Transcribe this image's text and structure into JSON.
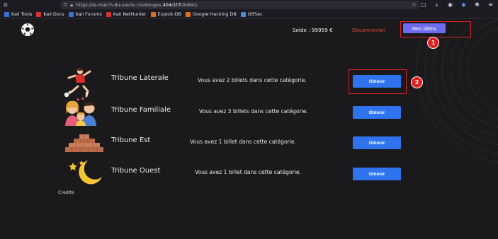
{
  "browser": {
    "url_prefix": "https://le-match-du-siecle.challenges.",
    "url_domain": "404ctf.fr",
    "url_path": "/billets",
    "bookmarks": [
      {
        "label": "Kali Tools",
        "color": "#3a74d8"
      },
      {
        "label": "Kali Docs",
        "color": "#d8322e"
      },
      {
        "label": "Kali Forums",
        "color": "#3a74d8"
      },
      {
        "label": "Kali NetHunter",
        "color": "#d8322e"
      },
      {
        "label": "Exploit-DB",
        "color": "#e0701e"
      },
      {
        "label": "Google Hacking DB",
        "color": "#e0701e"
      },
      {
        "label": "OffSec",
        "color": "#4a8ad8"
      }
    ]
  },
  "header": {
    "solde": "Solde : 99959 €",
    "logout_label": "Déconnexion",
    "mes_billets_label": "Mes billets"
  },
  "annotations": {
    "badge1": "1",
    "badge2": "2",
    "color": "#e02020"
  },
  "tribunes": [
    {
      "title": "Tribune Laterale",
      "desc": "Vous avez 2 billets dans cette catégorie.",
      "button": "Obtenir",
      "icon": "football-player-icon"
    },
    {
      "title": "Tribune Familiale",
      "desc": "Vous avez 3 billets dans cette catégorie.",
      "button": "Obtenir",
      "icon": "family-icon"
    },
    {
      "title": "Tribune Est",
      "desc": "Vous avez 1 billet dans cette catégorie.",
      "button": "Obtenir",
      "icon": "bleachers-icon"
    },
    {
      "title": "Tribune Ouest",
      "desc": "Vous avez 1 billet dans cette catégorie.",
      "button": "Obtenir",
      "icon": "moon-stars-icon"
    }
  ],
  "footer": {
    "credits": "Credits"
  },
  "colors": {
    "accent_button": "#2f74ee",
    "mes_billets": "#6b6cf0",
    "logout": "#e0443c",
    "background": "#1a1a1c"
  }
}
